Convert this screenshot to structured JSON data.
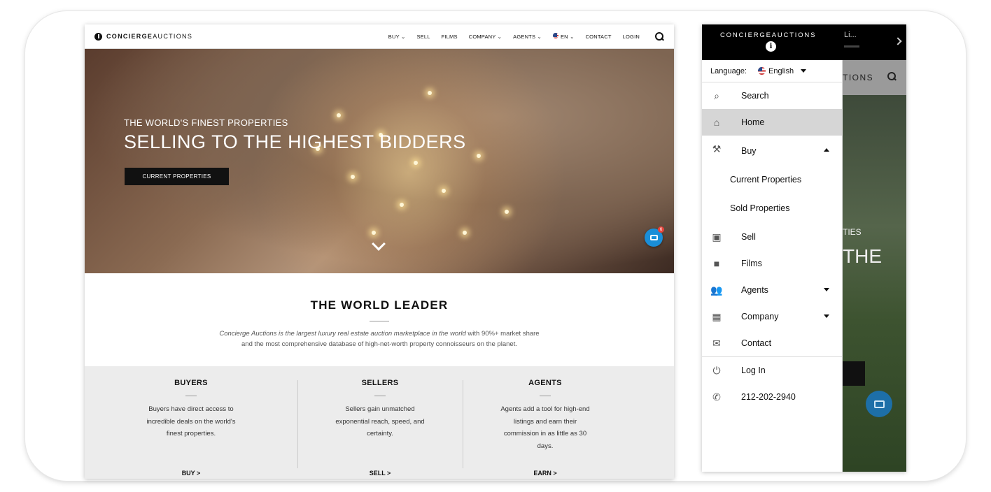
{
  "desktop": {
    "logo": {
      "bold": "CONCIERGE",
      "light": "AUCTIONS"
    },
    "nav": {
      "buy": "BUY",
      "sell": "SELL",
      "films": "FILMS",
      "company": "COMPANY",
      "agents": "AGENTS",
      "lang": "EN",
      "contact": "CONTACT",
      "login": "LOGIN"
    },
    "hero": {
      "kicker": "THE WORLD'S FINEST PROPERTIES",
      "headline": "SELLING TO THE HIGHEST BIDDERS",
      "cta": "CURRENT PROPERTIES",
      "chat_badge": "6"
    },
    "leader": {
      "title": "THE WORLD LEADER",
      "italic": "Concierge Auctions is the largest luxury real estate auction marketplace in the world",
      "rest": " with 90%+ market share and the most comprehensive database of high-net-worth property connoisseurs on the planet."
    },
    "columns": [
      {
        "title": "BUYERS",
        "text": "Buyers have direct access to incredible deals on the world's finest properties.",
        "link": "BUY >"
      },
      {
        "title": "SELLERS",
        "text": "Sellers gain unmatched exponential reach, speed, and certainty.",
        "link": "SELL >"
      },
      {
        "title": "AGENTS",
        "text": "Agents add a tool for high-end listings and earn their commission in as little as 30 days.",
        "link": "EARN >"
      }
    ]
  },
  "mobile": {
    "brand": "CONCIERGEAUCTIONS",
    "info_glyph": "i",
    "top_right": "Li...",
    "bar_text": "TIONS",
    "bg_text1": "TIES",
    "bg_text2": "THE",
    "language_label": "Language:",
    "language_value": "English",
    "menu": {
      "search": "Search",
      "home": "Home",
      "buy": "Buy",
      "current": "Current Properties",
      "sold": "Sold Properties",
      "sell": "Sell",
      "films": "Films",
      "agents": "Agents",
      "company": "Company",
      "contact": "Contact",
      "login": "Log In",
      "phone": "212-202-2940"
    },
    "icons": {
      "search": "⌕",
      "home": "⌂",
      "buy": "⚒",
      "sell": "▣",
      "films": "■",
      "agents": "👥",
      "company": "▦",
      "contact": "✉",
      "login": "⏻",
      "phone": "✆"
    }
  }
}
